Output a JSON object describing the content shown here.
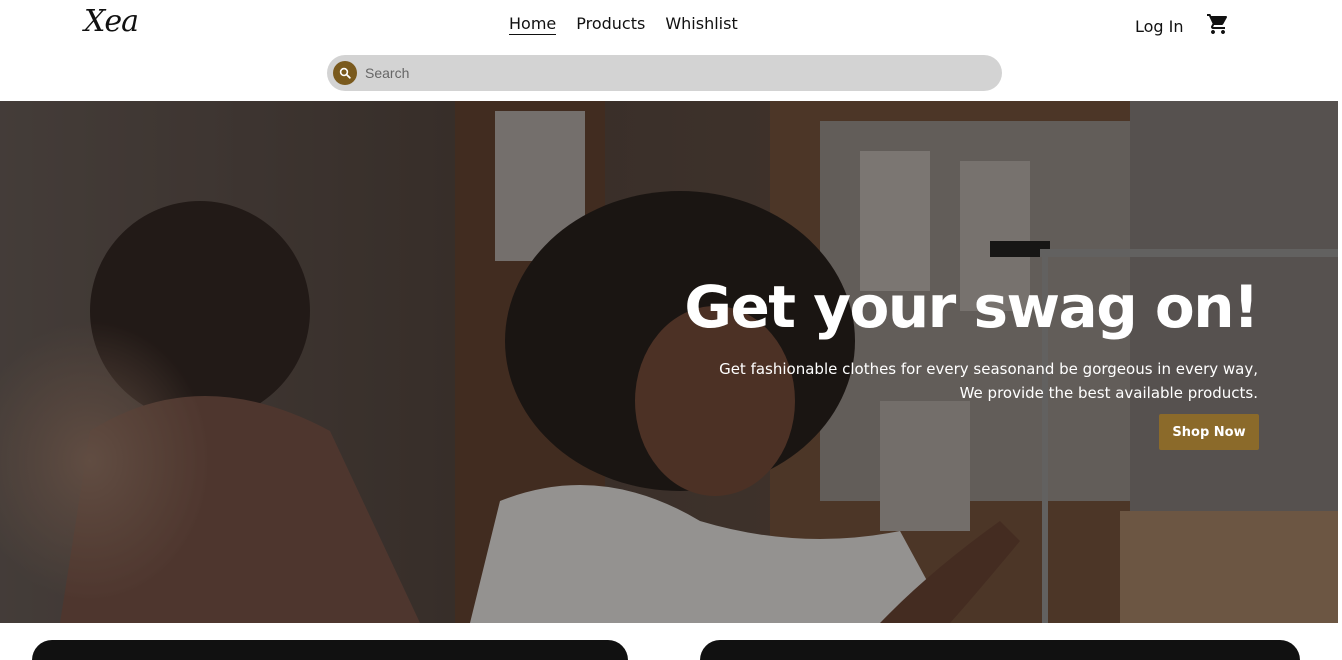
{
  "brand": {
    "logo_text": "Xea"
  },
  "nav": {
    "items": [
      {
        "label": "Home",
        "active": true
      },
      {
        "label": "Products",
        "active": false
      },
      {
        "label": "Whishlist",
        "active": false
      }
    ]
  },
  "account": {
    "login_label": "Log In"
  },
  "search": {
    "placeholder": "Search"
  },
  "hero": {
    "title": "Get your swag on!",
    "subtitle_line1": "Get fashionable clothes for every seasonand be gorgeous in every way,",
    "subtitle_line2": "We provide the best available products.",
    "cta_label": "Shop Now"
  },
  "icons": {
    "cart": "shopping-cart-icon",
    "search": "search-icon"
  },
  "colors": {
    "accent": "#8b6a2a",
    "search_button": "#7a5a1e",
    "search_bg": "#d3d3d3",
    "text": "#111111"
  }
}
